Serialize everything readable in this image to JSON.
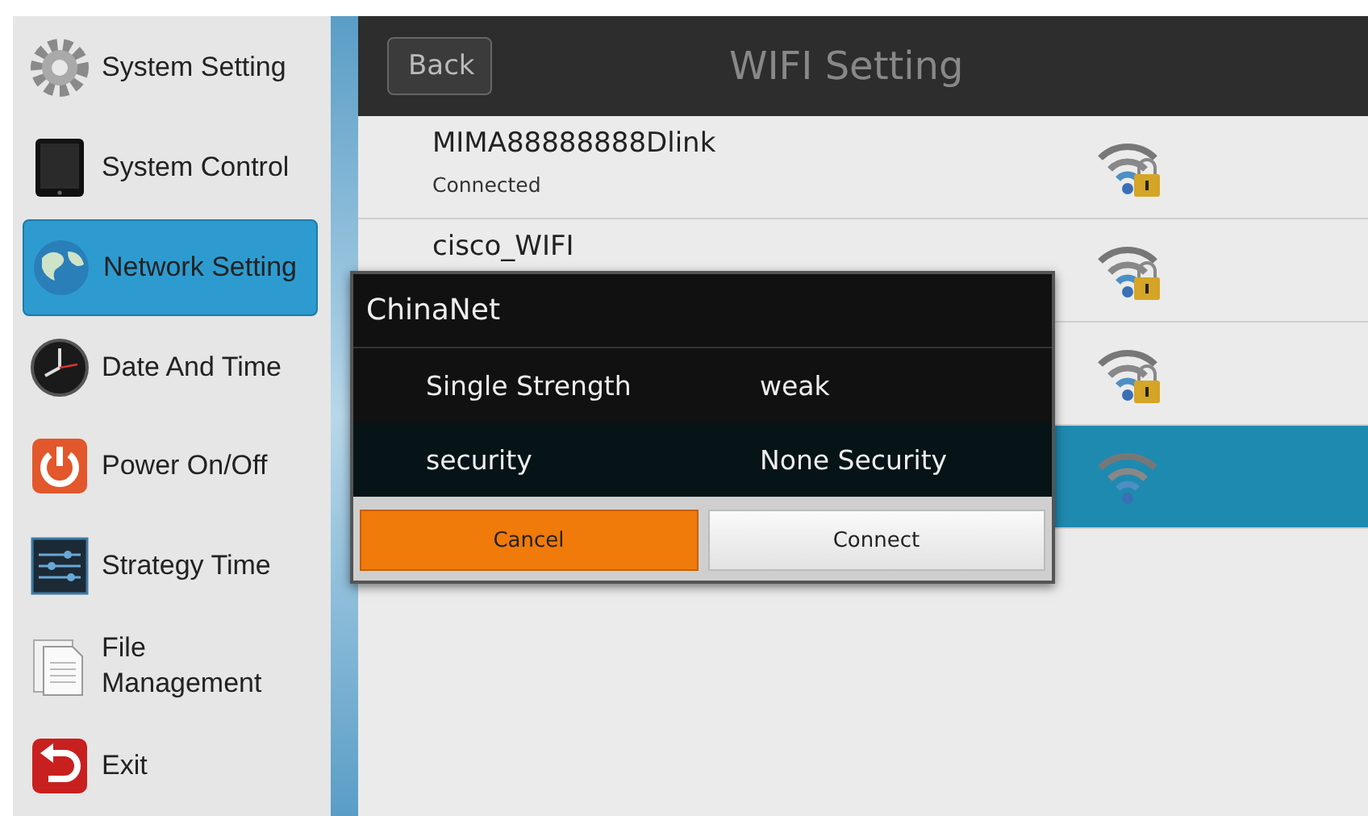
{
  "sidebar": {
    "items": [
      {
        "label": "System Setting",
        "selected": false
      },
      {
        "label": "System Control",
        "selected": false
      },
      {
        "label": "Network Setting",
        "selected": true
      },
      {
        "label": "Date And Time",
        "selected": false
      },
      {
        "label": "Power On/Off",
        "selected": false
      },
      {
        "label": "Strategy Time",
        "selected": false
      },
      {
        "label": "File Management",
        "selected": false
      },
      {
        "label": "Exit",
        "selected": false
      }
    ]
  },
  "header": {
    "back_button": "Back",
    "title": "WIFI Setting"
  },
  "networks": [
    {
      "name": "MIMA88888888Dlink",
      "status": "Connected",
      "locked": true,
      "selected": false
    },
    {
      "name": "cisco_WIFI",
      "locked": true,
      "selected": false
    },
    {
      "locked": true,
      "selected": false
    },
    {
      "locked": false,
      "selected": true
    }
  ],
  "dialog": {
    "title": "ChinaNet",
    "rows": [
      {
        "label": "Single Strength",
        "value": "weak"
      },
      {
        "label": "security",
        "value": "None Security"
      }
    ],
    "buttons": [
      {
        "label": "Cancel",
        "kind": "primary"
      },
      {
        "label": "Connect",
        "kind": "secondary"
      }
    ]
  }
}
